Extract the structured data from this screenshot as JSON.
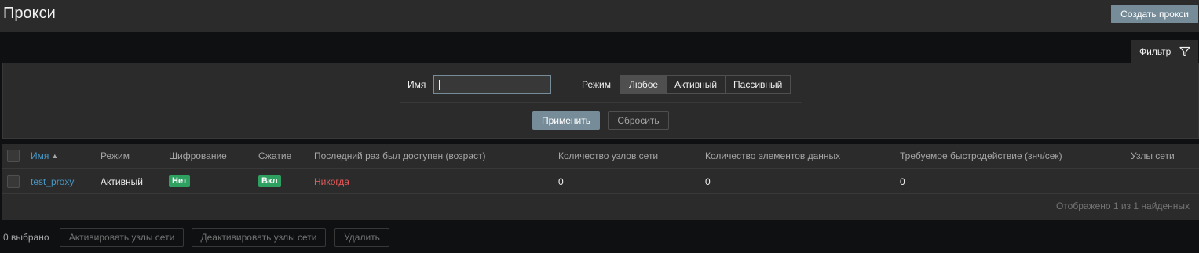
{
  "header": {
    "title": "Прокси",
    "create_button": "Создать прокси"
  },
  "filter": {
    "tab_label": "Фильтр",
    "name_label": "Имя",
    "name_value": "",
    "mode_label": "Режим",
    "mode_options": [
      "Любое",
      "Активный",
      "Пассивный"
    ],
    "mode_selected": "Любое",
    "apply_button": "Применить",
    "reset_button": "Сбросить"
  },
  "table": {
    "columns": [
      "Имя",
      "Режим",
      "Шифрование",
      "Сжатие",
      "Последний раз был доступен (возраст)",
      "Количество узлов сети",
      "Количество элементов данных",
      "Требуемое быстродействие (знч/сек)",
      "Узлы сети"
    ],
    "sort_indicator": "▲",
    "rows": [
      {
        "name": "test_proxy",
        "mode": "Активный",
        "encryption": "Нет",
        "compression": "Вкл",
        "last_seen": "Никогда",
        "host_count": "0",
        "item_count": "0",
        "performance": "0",
        "hosts": ""
      }
    ],
    "footer": "Отображено 1 из 1 найденных"
  },
  "actions": {
    "selected_count": "0 выбрано",
    "enable_hosts": "Активировать узлы сети",
    "disable_hosts": "Деактивировать узлы сети",
    "delete": "Удалить"
  },
  "colors": {
    "background": "#0e1012",
    "panel": "#2b2b2b",
    "accent_button": "#768d99",
    "link": "#4796c4",
    "status_green": "#2ea060",
    "status_red": "#e45959"
  }
}
